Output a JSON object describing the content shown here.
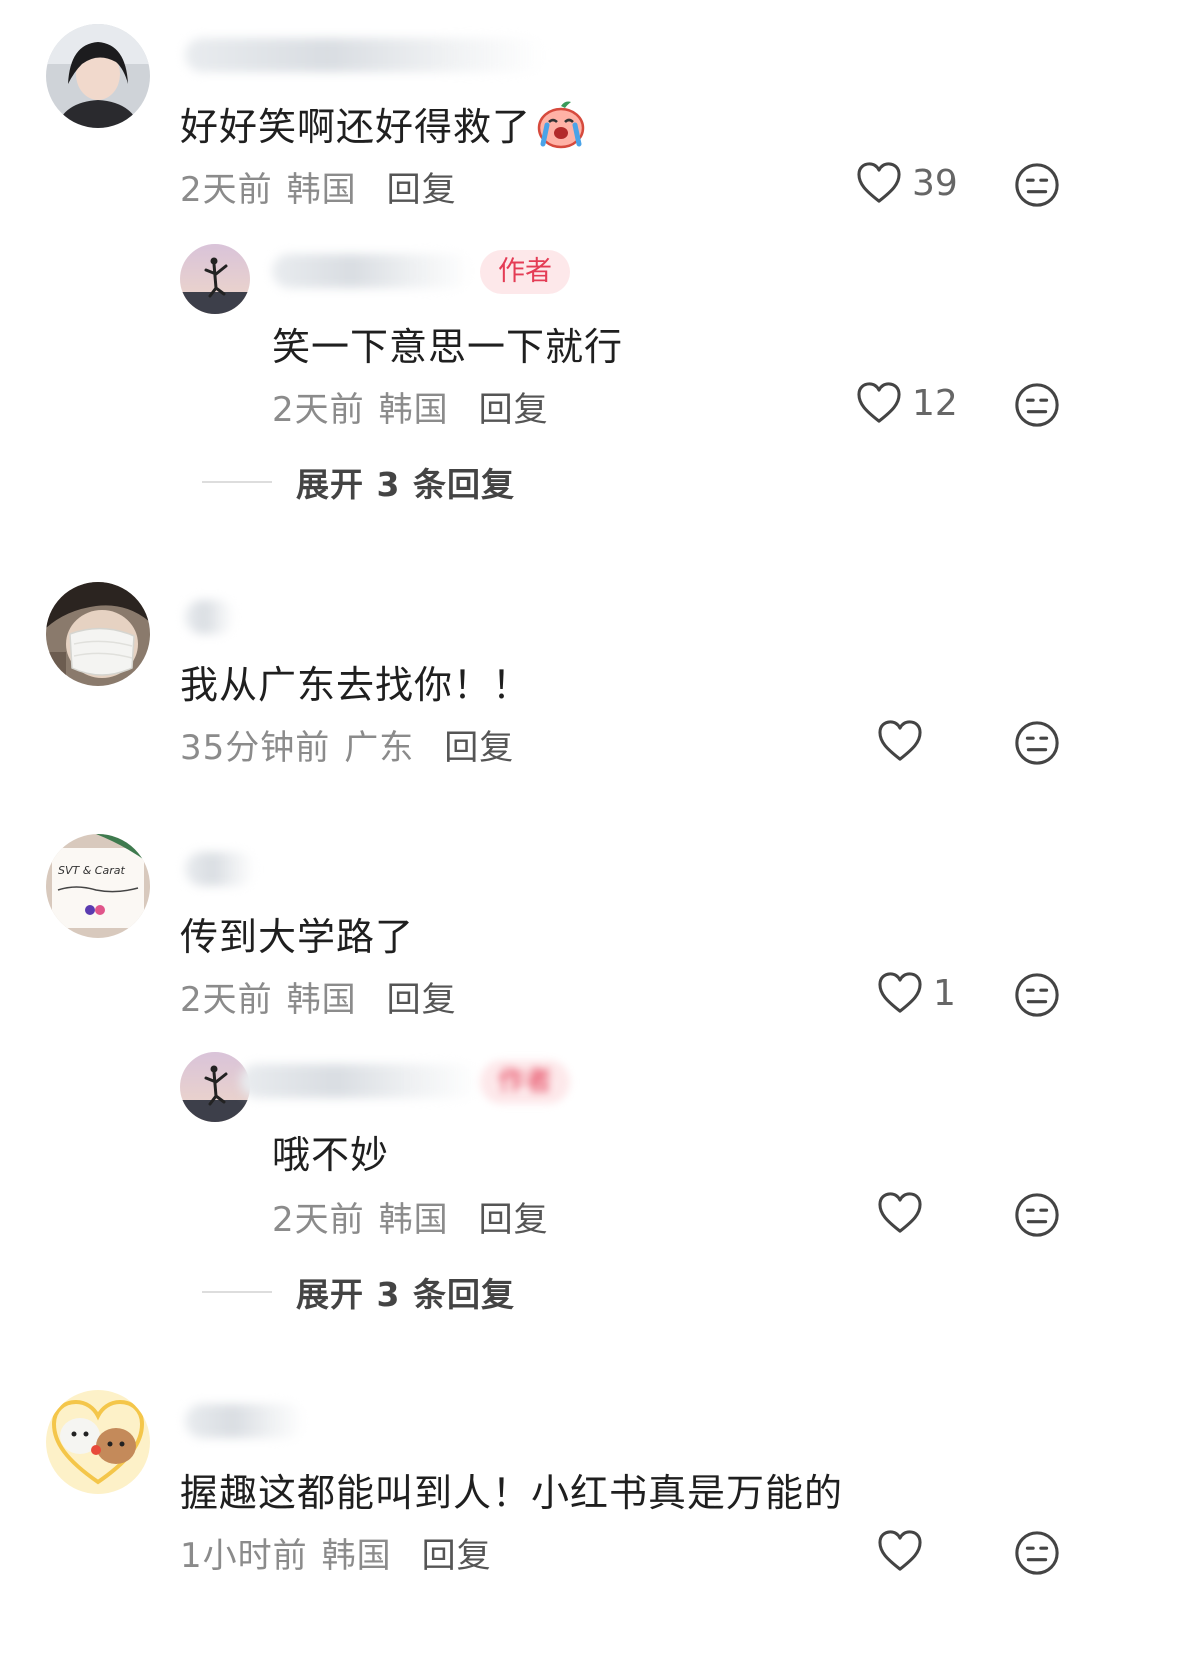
{
  "comments": [
    {
      "text": "好好笑啊还好得救了",
      "time": "2天前",
      "location": "韩国",
      "reply_label": "回复",
      "likes": "39",
      "reply": {
        "badge": "作者",
        "text": "笑一下意思一下就行",
        "time": "2天前",
        "location": "韩国",
        "reply_label": "回复",
        "likes": "12"
      },
      "expand_label": "展开 3 条回复"
    },
    {
      "text": "我从广东去找你！！",
      "time": "35分钟前",
      "location": "广东",
      "reply_label": "回复",
      "likes": ""
    },
    {
      "text": "传到大学路了",
      "time": "2天前",
      "location": "韩国",
      "reply_label": "回复",
      "likes": "1",
      "reply": {
        "badge": "作者",
        "text": "哦不妙",
        "time": "2天前",
        "location": "韩国",
        "reply_label": "回复",
        "likes": ""
      },
      "expand_label": "展开 3 条回复"
    },
    {
      "text": "握趣这都能叫到人！小红书真是万能的",
      "time": "1小时前",
      "location": "韩国",
      "reply_label": "回复",
      "likes": ""
    }
  ],
  "avatar_note_text": "SVT & Carat",
  "icons": {
    "like": "heart-outline-icon",
    "dislike": "neutral-face-icon",
    "emoji": "crying-peach-emoji"
  },
  "colors": {
    "author_badge_bg": "#fde8ea",
    "author_badge_text": "#e43c55",
    "meta": "#8b8b8b"
  }
}
